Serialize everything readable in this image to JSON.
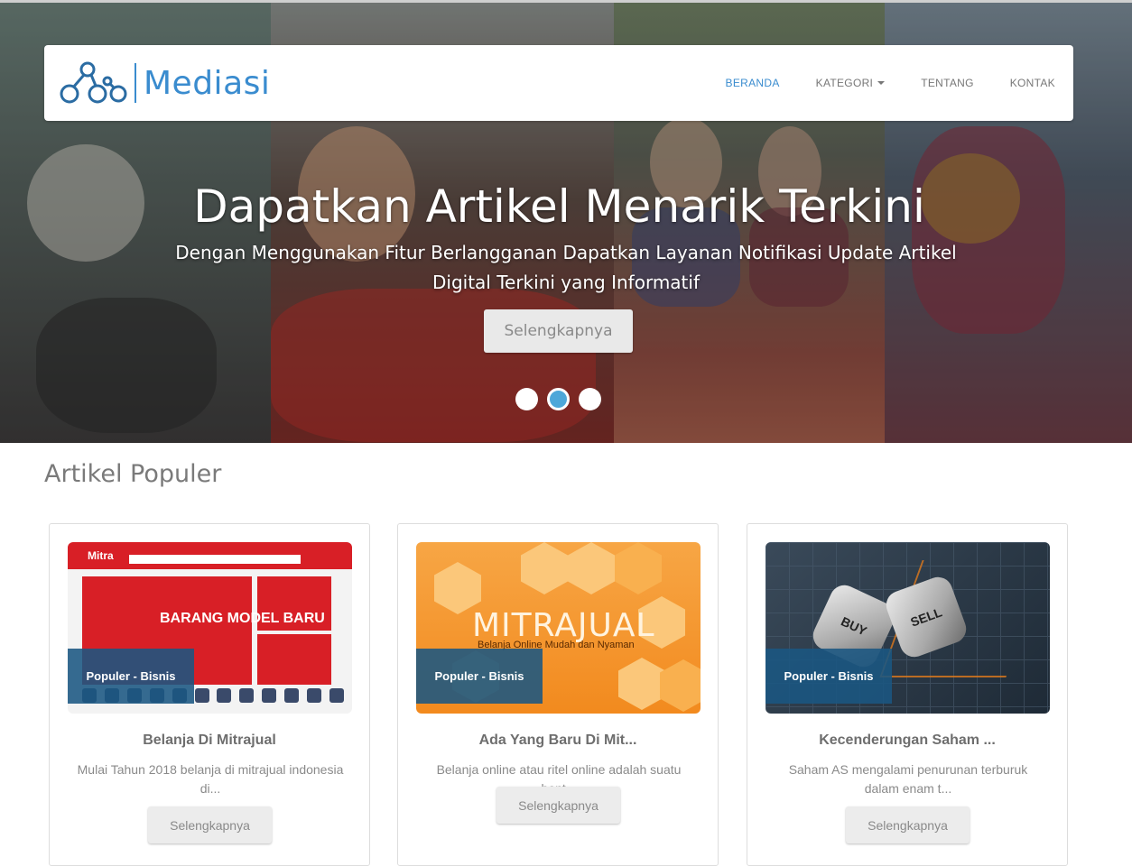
{
  "brand": {
    "name": "Mediasi"
  },
  "nav": {
    "items": [
      {
        "label": "BERANDA",
        "active": true
      },
      {
        "label": "KATEGORI",
        "dropdown": true
      },
      {
        "label": "TENTANG"
      },
      {
        "label": "KONTAK"
      }
    ]
  },
  "hero": {
    "title": "Dapatkan Artikel Menarik Terkini",
    "subtitle": "Dengan Menggunakan Fitur Berlangganan Dapatkan Layanan Notifikasi Update Artikel Digital Terkini yang Informatif",
    "button": "Selengkapnya",
    "slides": 3,
    "active_slide": 2
  },
  "section": {
    "title": "Artikel Populer"
  },
  "cards": [
    {
      "badge": "Populer - Bisnis",
      "title": "Belanja Di Mitrajual",
      "text": "Mulai Tahun 2018 belanja di mitrajual indonesia di...",
      "button": "Selengkapnya",
      "thumb": {
        "brand": "Mitra",
        "headline": "BARANG MODEL BARU"
      }
    },
    {
      "badge": "Populer - Bisnis",
      "title": "Ada Yang Baru Di Mit...",
      "text": "Belanja online atau ritel online adalah suatu bent...",
      "button": "Selengkapnya",
      "thumb": {
        "word": "MITRAJUAL",
        "sub": "Belanja Online Mudah dan Nyaman"
      }
    },
    {
      "badge": "Populer - Bisnis",
      "title": "Kecenderungan Saham ...",
      "text": "Saham AS mengalami penurunan terburuk dalam enam t...",
      "button": "Selengkapnya",
      "thumb": {
        "die1": "BUY",
        "die2": "SELL"
      }
    }
  ],
  "colors": {
    "accent": "#3a8ccf",
    "badge": "#1a5682",
    "active_dot": "#4da7d9"
  }
}
